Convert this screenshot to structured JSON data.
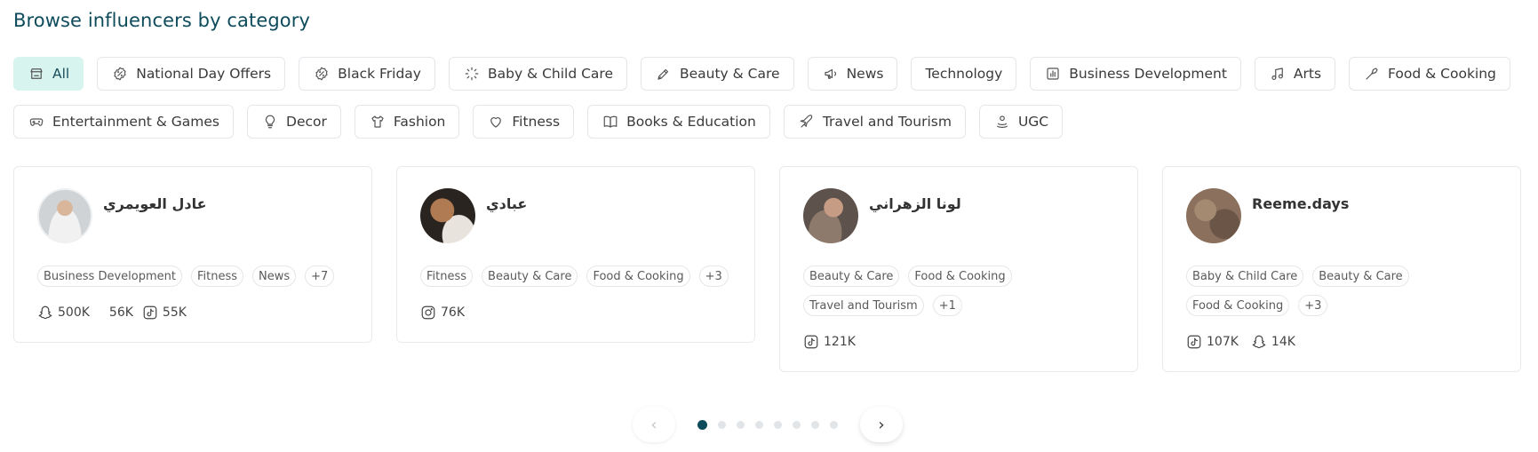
{
  "section_title": "Browse influencers by category",
  "categories_row1": [
    {
      "label": "All",
      "icon": "store-icon",
      "active": true
    },
    {
      "label": "National Day Offers",
      "icon": "discount-badge-icon"
    },
    {
      "label": "Black Friday",
      "icon": "discount-badge-icon"
    },
    {
      "label": "Baby & Child Care",
      "icon": "loader-icon"
    },
    {
      "label": "Beauty & Care",
      "icon": "pen-icon"
    },
    {
      "label": "News",
      "icon": "megaphone-icon"
    },
    {
      "label": "Technology",
      "icon": ""
    },
    {
      "label": "Business Development",
      "icon": "bar-chart-icon"
    },
    {
      "label": "Arts",
      "icon": "music-note-icon"
    },
    {
      "label": "Food & Cooking",
      "icon": "spatula-icon"
    }
  ],
  "categories_row2": [
    {
      "label": "Entertainment & Games",
      "icon": "gamepad-icon"
    },
    {
      "label": "Decor",
      "icon": "lightbulb-icon"
    },
    {
      "label": "Fashion",
      "icon": "shirt-icon"
    },
    {
      "label": "Fitness",
      "icon": "heart-icon"
    },
    {
      "label": "Books & Education",
      "icon": "book-icon"
    },
    {
      "label": "Travel and Tourism",
      "icon": "airplane-icon"
    },
    {
      "label": "UGC",
      "icon": "ugc-icon"
    }
  ],
  "influencers": [
    {
      "name": "عادل العويمري",
      "tags": [
        "Business Development",
        "Fitness",
        "News",
        "+7"
      ],
      "stats": [
        {
          "icon": "snapchat-icon",
          "value": "500K"
        },
        {
          "icon": "",
          "value": "56K"
        },
        {
          "icon": "tiktok-icon",
          "value": "55K"
        }
      ]
    },
    {
      "name": "عبادي",
      "tags": [
        "Fitness",
        "Beauty & Care",
        "Food & Cooking",
        "+3"
      ],
      "stats": [
        {
          "icon": "instagram-icon",
          "value": "76K"
        }
      ]
    },
    {
      "name": "لونا الزهراني",
      "tags": [
        "Beauty & Care",
        "Food & Cooking",
        "Travel and Tourism",
        "+1"
      ],
      "stats": [
        {
          "icon": "tiktok-icon",
          "value": "121K"
        }
      ]
    },
    {
      "name": "Reeme.days",
      "tags": [
        "Baby & Child Care",
        "Beauty & Care",
        "Food & Cooking",
        "+3"
      ],
      "stats": [
        {
          "icon": "tiktok-icon",
          "value": "107K"
        },
        {
          "icon": "snapchat-icon",
          "value": "14K"
        }
      ]
    }
  ],
  "pagination": {
    "prev_label": "‹",
    "next_label": "›",
    "page_count": 8,
    "current_page": 1
  },
  "colors": {
    "accent": "#0e4c5c",
    "active_chip_bg": "#d8f4ef"
  }
}
